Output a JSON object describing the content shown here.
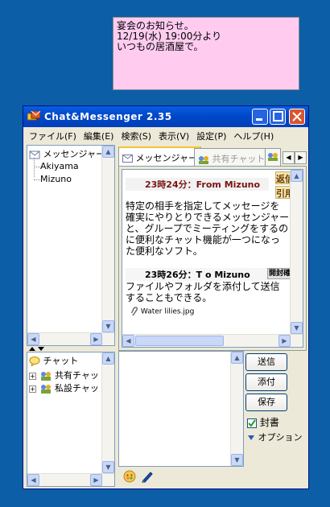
{
  "note": {
    "lines": [
      "宴会のお知らせ。",
      "12/19(水) 19:00分より",
      "いつもの居酒屋で。"
    ]
  },
  "window": {
    "title": "Chat&Messenger 2.35"
  },
  "menu": [
    "ファイル(F)",
    "編集(E)",
    "検索(S)",
    "表示(V)",
    "設定(P)",
    "ヘルプ(H)"
  ],
  "users_tree": {
    "root": "メッセンジャー",
    "users": [
      "Akiyama",
      "Mizuno"
    ]
  },
  "chat_tree": {
    "root": "チャット",
    "items": [
      "共有チャッ",
      "私設チャッ"
    ]
  },
  "tabs": [
    "メッセンジャー",
    "共有チャット"
  ],
  "messages": [
    {
      "header": "23時24分：From Mizuno",
      "action1": "返信",
      "action2": "引用",
      "body_lines": [
        "特定の相手を指定してメッセージを",
        "確実にやりとりできるメッセンジャー",
        "と、グループでミーティングをするの",
        "に便利なチャット機能が一つになっ",
        "た便利なソフト。"
      ]
    },
    {
      "header": "23時26分：T o Mizuno",
      "action1": "開封確",
      "body_lines": [
        "ファイルやフォルダを添付して送信",
        "することもできる。"
      ],
      "attachment": "Water lilies.jpg"
    }
  ],
  "compose": {
    "send_label": "送信",
    "attach_label": "添付",
    "save_label": "保存",
    "seal_label": "封書",
    "seal_checked": true,
    "options_label": "オプション"
  },
  "colors": {
    "desktop": "#0c5ea6",
    "note": "#ffccf0",
    "header_text": "#7a1414"
  }
}
